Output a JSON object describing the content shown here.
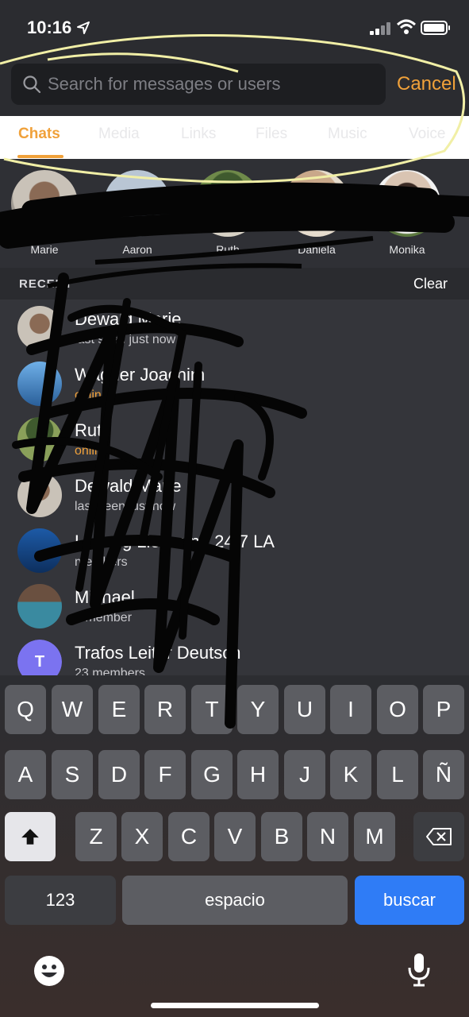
{
  "status": {
    "time": "10:16"
  },
  "search": {
    "placeholder": "Search for messages or users",
    "cancel_label": "Cancel"
  },
  "tabs": [
    {
      "label": "Chats",
      "active": true
    },
    {
      "label": "Media"
    },
    {
      "label": "Links"
    },
    {
      "label": "Files"
    },
    {
      "label": "Music"
    },
    {
      "label": "Voice"
    }
  ],
  "people": [
    {
      "name": "Marie"
    },
    {
      "name": "Aaron"
    },
    {
      "name": "Ruth"
    },
    {
      "name": "Daniela"
    },
    {
      "name": "Monika"
    }
  ],
  "recent": {
    "title": "RECENT",
    "clear_label": "Clear",
    "items": [
      {
        "name": "Dewald Marie",
        "sub": "last seen just now"
      },
      {
        "name": "Wagner Joachim",
        "sub": "online"
      },
      {
        "name": "Ruth",
        "sub": "online"
      },
      {
        "name": "Dewald Marie",
        "sub": "last seen just now"
      },
      {
        "name": "Leitung Lieferung 24/7 LA",
        "sub": "members"
      },
      {
        "name": "Michael",
        "sub": "1 member"
      },
      {
        "name": "Trafos Leiter Deutsch",
        "sub": "23 members",
        "letter": "T"
      }
    ]
  },
  "keyboard": {
    "row1": [
      "Q",
      "W",
      "E",
      "R",
      "T",
      "Y",
      "U",
      "I",
      "O",
      "P"
    ],
    "row2": [
      "A",
      "S",
      "D",
      "F",
      "G",
      "H",
      "J",
      "K",
      "L",
      "Ñ"
    ],
    "row3": [
      "Z",
      "X",
      "C",
      "V",
      "B",
      "N",
      "M"
    ],
    "numbers_label": "123",
    "space_label": "espacio",
    "search_label": "buscar"
  },
  "colors": {
    "accent": "#f0a13a",
    "search_key": "#2f7cf6",
    "letter_avatar": "#7b73f0"
  }
}
